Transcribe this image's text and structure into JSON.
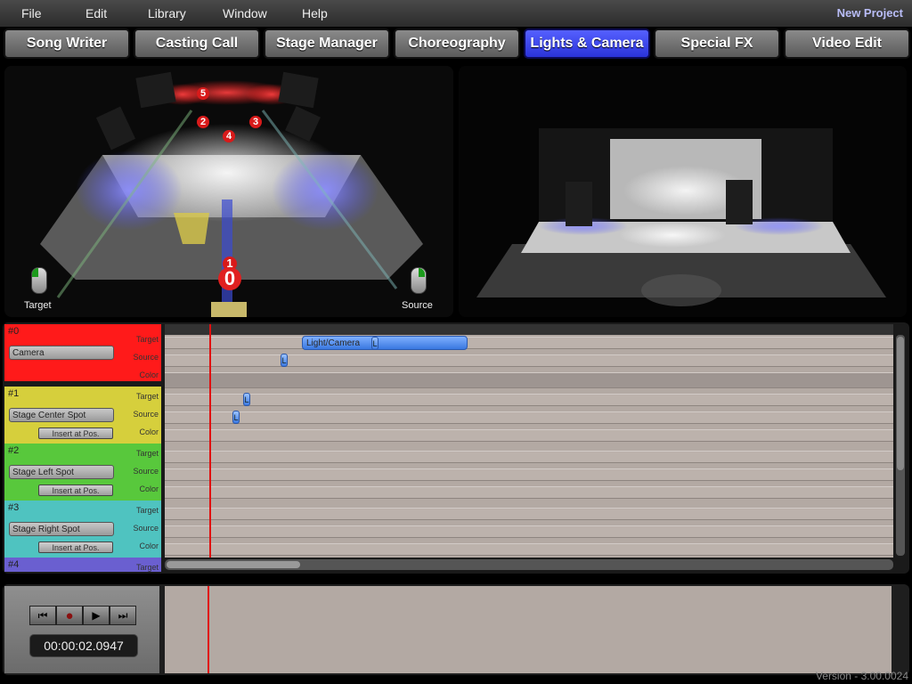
{
  "menu": {
    "file": "File",
    "edit": "Edit",
    "library": "Library",
    "window": "Window",
    "help": "Help",
    "project": "New Project"
  },
  "tabs": [
    {
      "label": "Song Writer"
    },
    {
      "label": "Casting Call"
    },
    {
      "label": "Stage Manager"
    },
    {
      "label": "Choreography"
    },
    {
      "label": "Lights & Camera",
      "active": true
    },
    {
      "label": "Special FX"
    },
    {
      "label": "Video Edit"
    }
  ],
  "views": {
    "target_label": "Target",
    "source_label": "Source",
    "light_numbers": [
      "5",
      "2",
      "3",
      "4",
      "1",
      "0"
    ]
  },
  "tracks": [
    {
      "num": "#0",
      "name": "Camera",
      "color": "#ff1a1a",
      "labels": [
        "Target",
        "Source",
        "Color"
      ]
    },
    {
      "num": "#1",
      "name": "Stage Center Spot",
      "insert": "Insert at Pos.",
      "color": "#d6cf3c",
      "labels": [
        "Target",
        "Source",
        "Color"
      ]
    },
    {
      "num": "#2",
      "name": "Stage Left Spot",
      "insert": "Insert at Pos.",
      "color": "#58c83c",
      "labels": [
        "Target",
        "Source",
        "Color"
      ]
    },
    {
      "num": "#3",
      "name": "Stage Right Spot",
      "insert": "Insert at Pos.",
      "color": "#4fc3c0",
      "labels": [
        "Target",
        "Source",
        "Color"
      ]
    },
    {
      "num": "#4",
      "name": "",
      "color": "#6a5fd0",
      "labels": [
        "Target"
      ]
    }
  ],
  "timeline": {
    "keybar_label": "Light/Camera",
    "kf_label": "L"
  },
  "transport": {
    "time": "00:00:02.0947"
  },
  "version": "Version - 3.00.0024",
  "colors": {
    "active_tab": "#3a44f0",
    "playhead": "#e01010"
  }
}
